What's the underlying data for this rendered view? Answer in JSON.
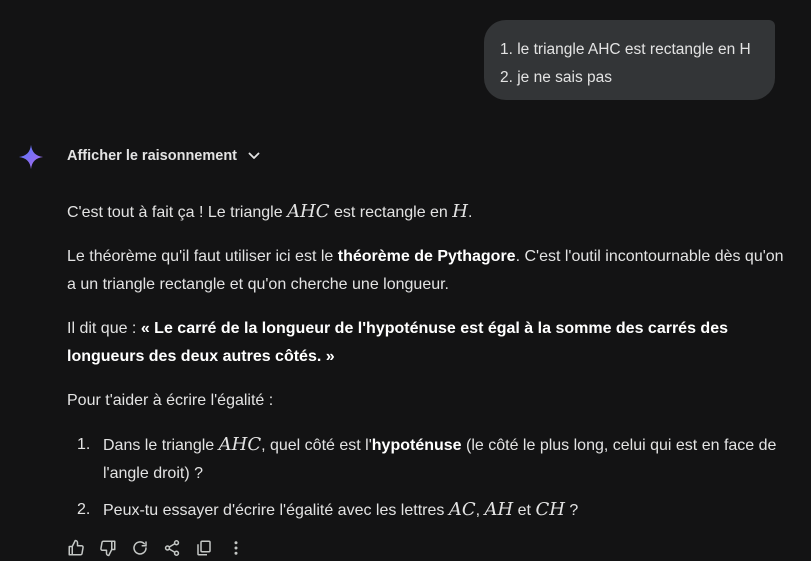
{
  "user_message": {
    "line1": "1. le triangle AHC est rectangle en H",
    "line2": "2. je ne sais pas"
  },
  "reasoning": {
    "label": "Afficher le raisonnement",
    "chevron_icon": "chevron-down-icon"
  },
  "response": {
    "p1": {
      "before": "C'est tout à fait ça ! Le triangle ",
      "math1": "AHC",
      "middle": " est rectangle en ",
      "math2": "H",
      "after": "."
    },
    "p2": {
      "before": "Le théorème qu'il faut utiliser ici est le ",
      "bold": "théorème de Pythagore",
      "after": ". C'est l'outil incontournable dès qu'on a un triangle rectangle et qu'on cherche une longueur."
    },
    "p3": {
      "before": "Il dit que : ",
      "bold": "« Le carré de la longueur de l'hypoténuse est égal à la somme des carrés des longueurs des deux autres côtés. »"
    },
    "p4": "Pour t'aider à écrire l'égalité :",
    "steps": [
      {
        "num": "1.",
        "before": "Dans le triangle ",
        "math": "AHC",
        "middle": ", quel côté est l'",
        "bold": "hypoténuse",
        "after": " (le côté le plus long, celui qui est en face de l'angle droit) ?"
      },
      {
        "num": "2.",
        "before": "Peux-tu essayer d'écrire l'égalité avec les lettres ",
        "math1": "AC",
        "sep": ", ",
        "math2": "AH",
        "and": " et ",
        "math3": "CH",
        "after": " ?"
      }
    ]
  },
  "actions": [
    "thumbs-up-icon",
    "thumbs-down-icon",
    "regenerate-icon",
    "share-icon",
    "copy-icon",
    "more-vert-icon"
  ],
  "colors": {
    "background": "#131314",
    "bubble": "#333537",
    "text": "#e3e3e3",
    "spark": "#6b8cff"
  }
}
